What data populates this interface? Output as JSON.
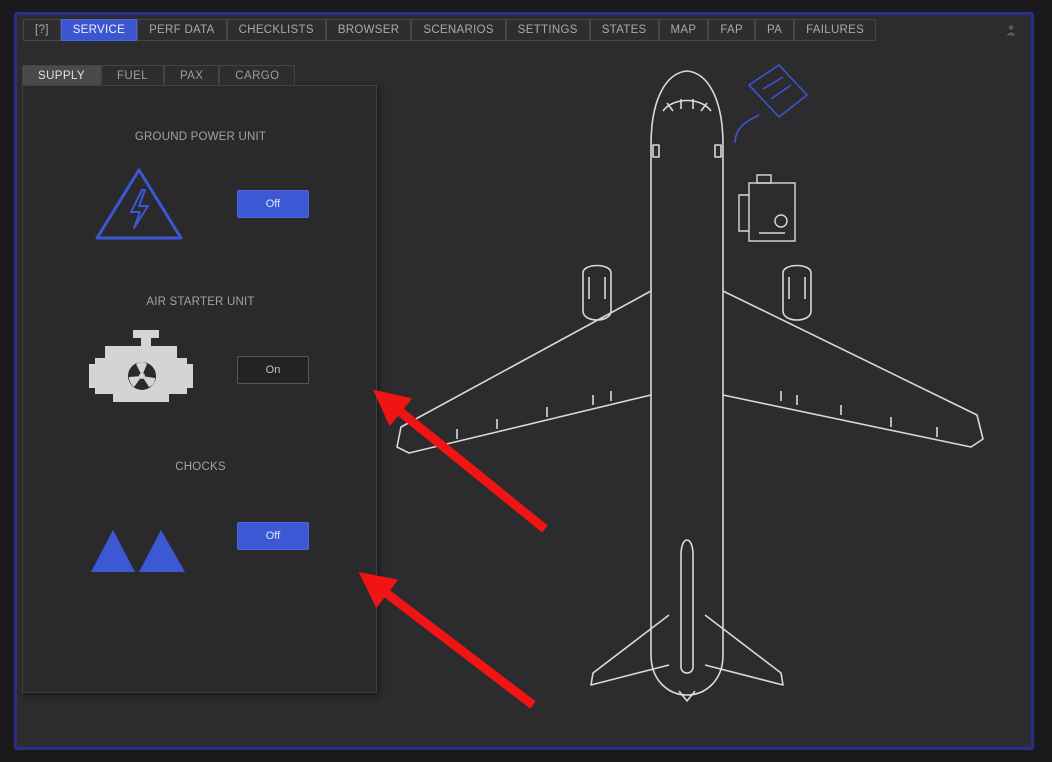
{
  "top_tabs": [
    "[?]",
    "SERVICE",
    "PERF DATA",
    "CHECKLISTS",
    "BROWSER",
    "SCENARIOS",
    "SETTINGS",
    "STATES",
    "MAP",
    "FAP",
    "PA",
    "FAILURES"
  ],
  "active_top_tab": "SERVICE",
  "sub_tabs": [
    "SUPPLY",
    "FUEL",
    "PAX",
    "CARGO"
  ],
  "active_sub_tab": "SUPPLY",
  "sections": {
    "gpu": {
      "title": "GROUND POWER UNIT",
      "button": "Off",
      "state": "off",
      "icon": "high-voltage-icon"
    },
    "asu": {
      "title": "AIR STARTER UNIT",
      "button": "On",
      "state": "on",
      "icon": "engine-icon"
    },
    "chocks": {
      "title": "CHOCKS",
      "button": "Off",
      "state": "off",
      "icon": "chocks-icon"
    }
  },
  "colors": {
    "accent": "#3c55d0",
    "frame_border": "#2a2e8a",
    "background": "#2c2c2e",
    "outline": "#d9d9dc",
    "annotation_arrow": "#f01414"
  },
  "annotations": [
    "red-arrow",
    "red-arrow"
  ]
}
